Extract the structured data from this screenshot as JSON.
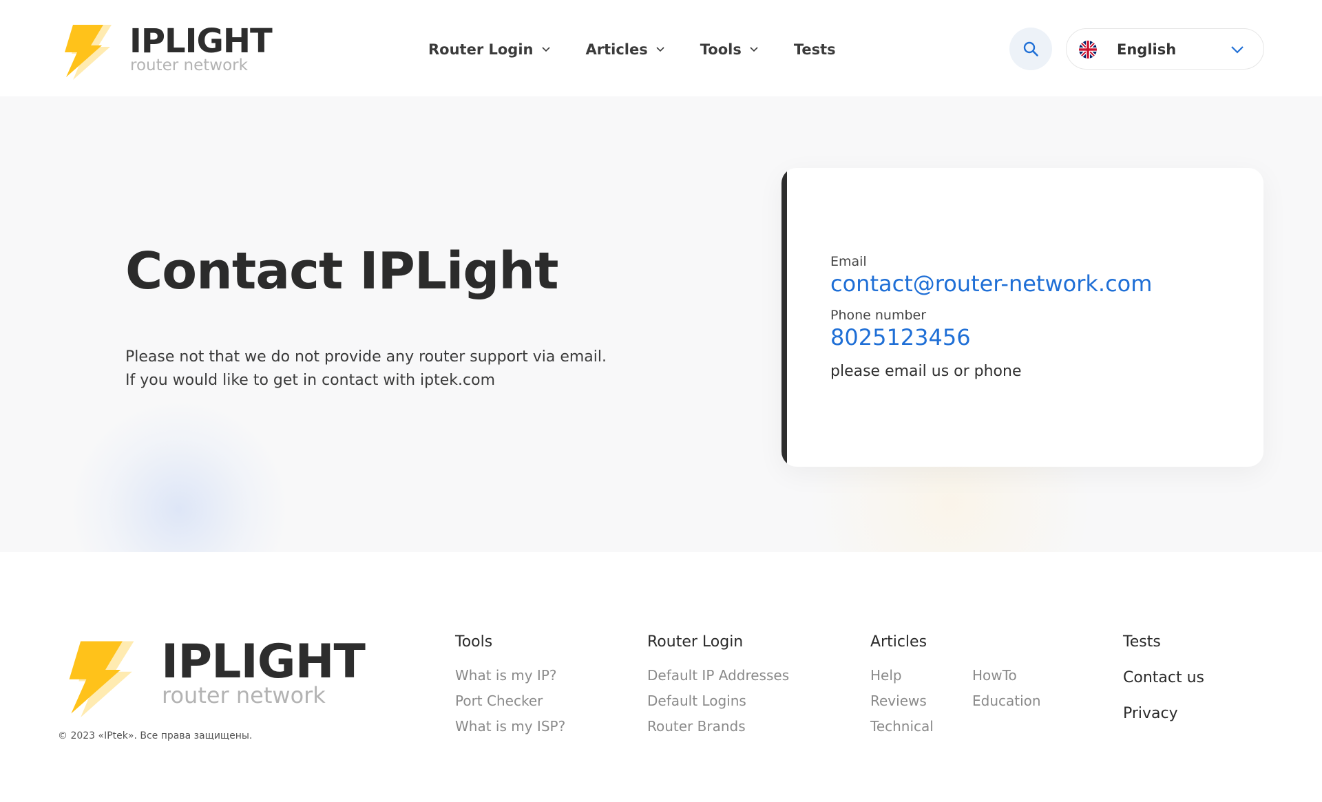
{
  "header": {
    "brand": "IPLIGHT",
    "tagline": "router network",
    "nav": [
      {
        "label": "Router Login"
      },
      {
        "label": "Articles"
      },
      {
        "label": "Tools"
      },
      {
        "label": "Tests"
      }
    ],
    "search_icon": "search-icon",
    "language": {
      "label": "English",
      "flag": "uk-flag-icon"
    }
  },
  "hero": {
    "title": "Contact IPLight",
    "description_line1": "Please not that we do not provide any router support via email.",
    "description_line2": "If you would like to get in contact with iptek.com"
  },
  "contact_card": {
    "email_label": "Email",
    "email": "contact@router-network.com",
    "phone_label": "Phone number",
    "phone": "8025123456",
    "note": "please email us or phone"
  },
  "footer": {
    "brand": "IPLIGHT",
    "tagline": "router network",
    "copyright": "© 2023 «IPtek». Все права защищены.",
    "tools": {
      "heading": "Tools",
      "links": [
        "What is my IP?",
        "Port Checker",
        "What is my ISP?"
      ]
    },
    "router_login": {
      "heading": "Router Login",
      "links": [
        "Default IP Addresses",
        "Default Logins",
        "Router Brands"
      ]
    },
    "articles": {
      "heading": "Articles",
      "links_col1": [
        "Help",
        "Reviews",
        "Technical"
      ],
      "links_col2": [
        "HowTo",
        "Education"
      ]
    },
    "misc": {
      "heading": "Tests",
      "links": [
        "Contact us",
        "Privacy"
      ]
    }
  },
  "colors": {
    "accent_blue": "#1f6fd6",
    "bolt_yellow": "#ffc21a",
    "text_dark": "#2d2d2d"
  }
}
